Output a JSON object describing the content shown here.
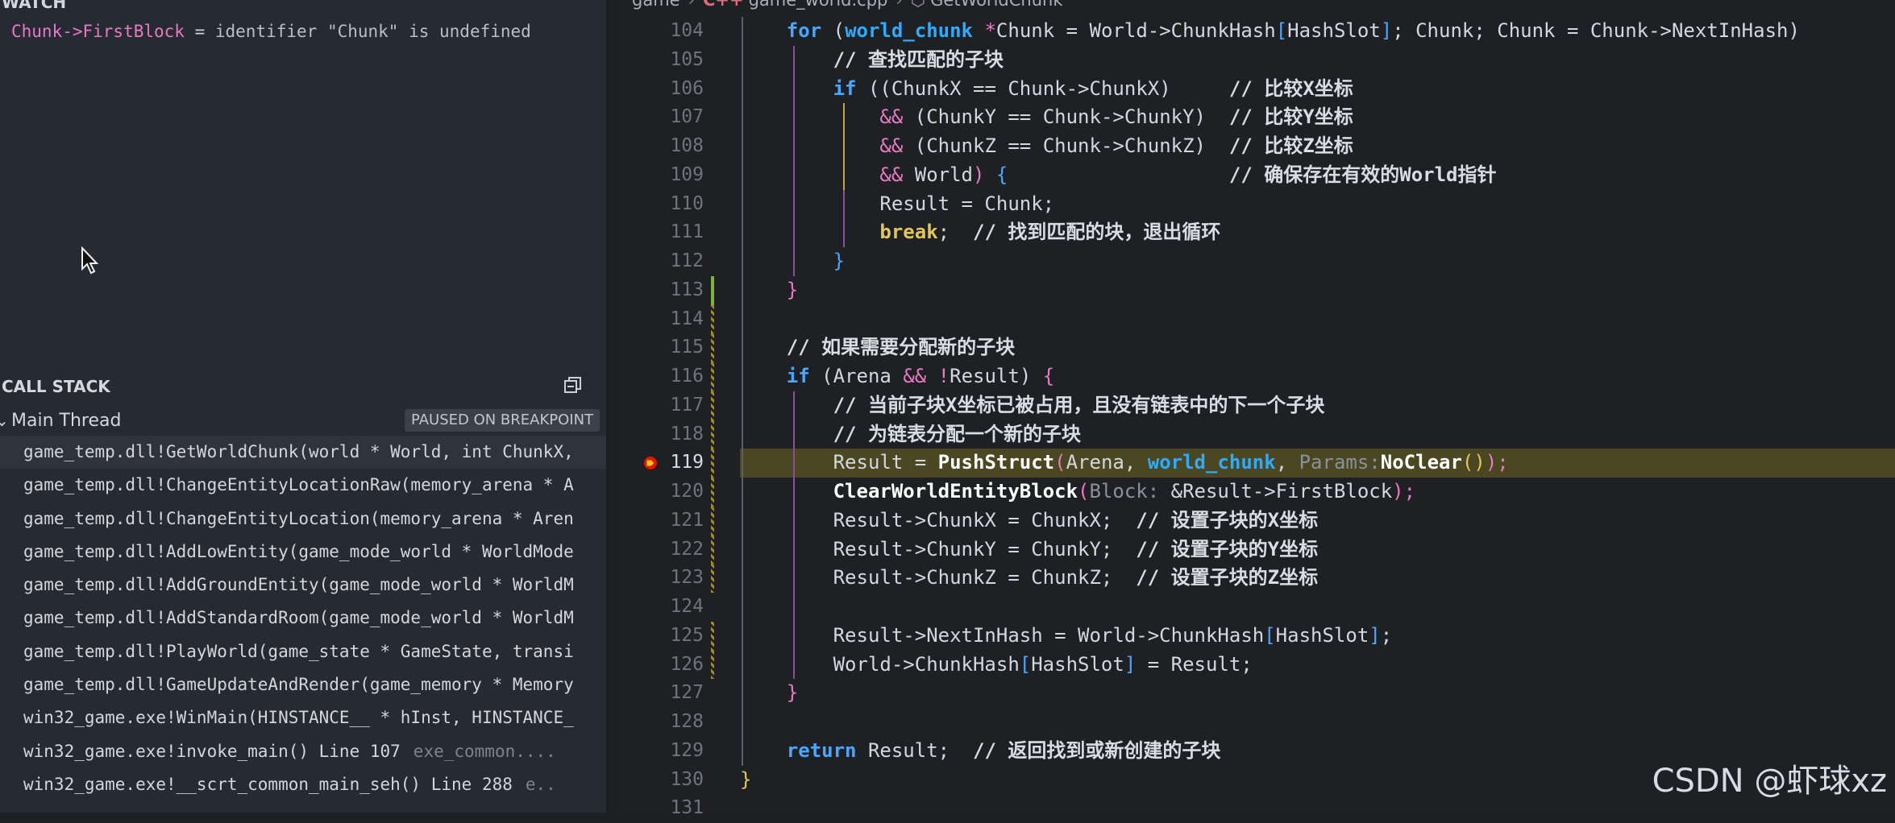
{
  "watch": {
    "header": "WATCH",
    "expression": "Chunk->FirstBlock",
    "equals": " = ",
    "value": "identifier \"Chunk\" is undefined"
  },
  "call_stack": {
    "header": "CALL STACK",
    "thread": "Main Thread",
    "badge": "PAUSED ON BREAKPOINT",
    "frames": [
      {
        "text": "game_temp.dll!GetWorldChunk(world * World, int ChunkX,",
        "src": ""
      },
      {
        "text": "game_temp.dll!ChangeEntityLocationRaw(memory_arena * A",
        "src": ""
      },
      {
        "text": "game_temp.dll!ChangeEntityLocation(memory_arena * Aren",
        "src": ""
      },
      {
        "text": "game_temp.dll!AddLowEntity(game_mode_world * WorldMode",
        "src": ""
      },
      {
        "text": "game_temp.dll!AddGroundEntity(game_mode_world * WorldM",
        "src": ""
      },
      {
        "text": "game_temp.dll!AddStandardRoom(game_mode_world * WorldM",
        "src": ""
      },
      {
        "text": "game_temp.dll!PlayWorld(game_state * GameState, transi",
        "src": ""
      },
      {
        "text": "game_temp.dll!GameUpdateAndRender(game_memory * Memory",
        "src": ""
      },
      {
        "text": "win32_game.exe!WinMain(HINSTANCE__ * hInst, HINSTANCE_",
        "src": ""
      },
      {
        "text": "win32_game.exe!invoke_main() Line 107",
        "src": "exe_common...."
      },
      {
        "text": "win32_game.exe!__scrt_common_main_seh() Line 288",
        "src": "e.."
      }
    ]
  },
  "breadcrumb": {
    "folder": "game",
    "lang_icon": "C++",
    "file": "game_world.cpp",
    "symbol": "GetWorldChunk"
  },
  "editor": {
    "current_line": "119",
    "line_numbers": [
      "104",
      "105",
      "106",
      "107",
      "108",
      "109",
      "110",
      "111",
      "112",
      "113",
      "114",
      "115",
      "116",
      "117",
      "118",
      "119",
      "120",
      "121",
      "122",
      "123",
      "124",
      "125",
      "126",
      "127",
      "128",
      "129",
      "130",
      "131"
    ]
  },
  "code": {
    "l104": {
      "kw": "for",
      "p1": " (",
      "type": "world_chunk",
      "p2": " ",
      "op": "*",
      "p3": "Chunk = World->ChunkHash",
      "b1": "[",
      "p4": "HashSlot",
      "b2": "]",
      "p5": "; Chunk; Chunk = Chunk->NextInHash)"
    },
    "l105": {
      "cm": "// 查找匹配的子块"
    },
    "l106": {
      "kw": "if",
      "p1": " ((",
      "p2": "ChunkX == Chunk->ChunkX",
      "p3": ")",
      "pad": "     ",
      "cm": "// 比较X坐标"
    },
    "l107": {
      "op": "&&",
      "p1": " (",
      "p2": "ChunkY == Chunk->ChunkY",
      "p3": ")",
      "pad": "  ",
      "cm": "// 比较Y坐标"
    },
    "l108": {
      "op": "&&",
      "p1": " (",
      "p2": "ChunkZ == Chunk->ChunkZ",
      "p3": ")",
      "pad": "  ",
      "cm": "// 比较Z坐标"
    },
    "l109": {
      "op": "&&",
      "p1": " World",
      "p2": ")",
      "p3": " {",
      "pad": "                   ",
      "cm": "// 确保存在有效的World指针"
    },
    "l110": {
      "p1": "Result = Chunk;"
    },
    "l111": {
      "kw": "break",
      "p1": ";  ",
      "cm": "// 找到匹配的块，退出循环"
    },
    "l112": {
      "p1": "}"
    },
    "l113": {
      "p1": "}"
    },
    "l115": {
      "cm": "// 如果需要分配新的子块"
    },
    "l116": {
      "kw": "if",
      "p1": " (",
      "p2": "Arena ",
      "op1": "&&",
      "p3": " ",
      "op2": "!",
      "p4": "Result",
      "p5": ")",
      "p6": " {"
    },
    "l117": {
      "cm": "// 当前子块X坐标已被占用，且没有链表中的下一个子块"
    },
    "l118": {
      "cm": "// 为链表分配一个新的子块"
    },
    "l119": {
      "p1": "Result = ",
      "fn": "PushStruct",
      "p2": "(",
      "p3": "Arena, ",
      "type": "world_chunk",
      "p4": ", ",
      "hint": "Params:",
      "fn2": "NoClear",
      "p5": "()",
      "p6": ");"
    },
    "l120": {
      "fn": "ClearWorldEntityBlock",
      "p1": "(",
      "hint": "Block:",
      "p2": " &Result->FirstBlock",
      "p3": ");"
    },
    "l121": {
      "p1": "Result->ChunkX = ChunkX;  ",
      "cm": "// 设置子块的X坐标"
    },
    "l122": {
      "p1": "Result->ChunkY = ChunkY;  ",
      "cm": "// 设置子块的Y坐标"
    },
    "l123": {
      "p1": "Result->ChunkZ = ChunkZ;  ",
      "cm": "// 设置子块的Z坐标"
    },
    "l125": {
      "p1": "Result->NextInHash = World->ChunkHash",
      "b1": "[",
      "p2": "HashSlot",
      "b2": "]",
      "p3": ";"
    },
    "l126": {
      "p1": "World->ChunkHash",
      "b1": "[",
      "p2": "HashSlot",
      "b2": "]",
      "p3": " = Result;"
    },
    "l127": {
      "p1": "}"
    },
    "l129": {
      "kw": "return",
      "p1": " Result;  ",
      "cm": "// 返回找到或新创建的子块"
    },
    "l130": {
      "p1": "}"
    }
  },
  "watermark": "CSDN @虾球xz"
}
